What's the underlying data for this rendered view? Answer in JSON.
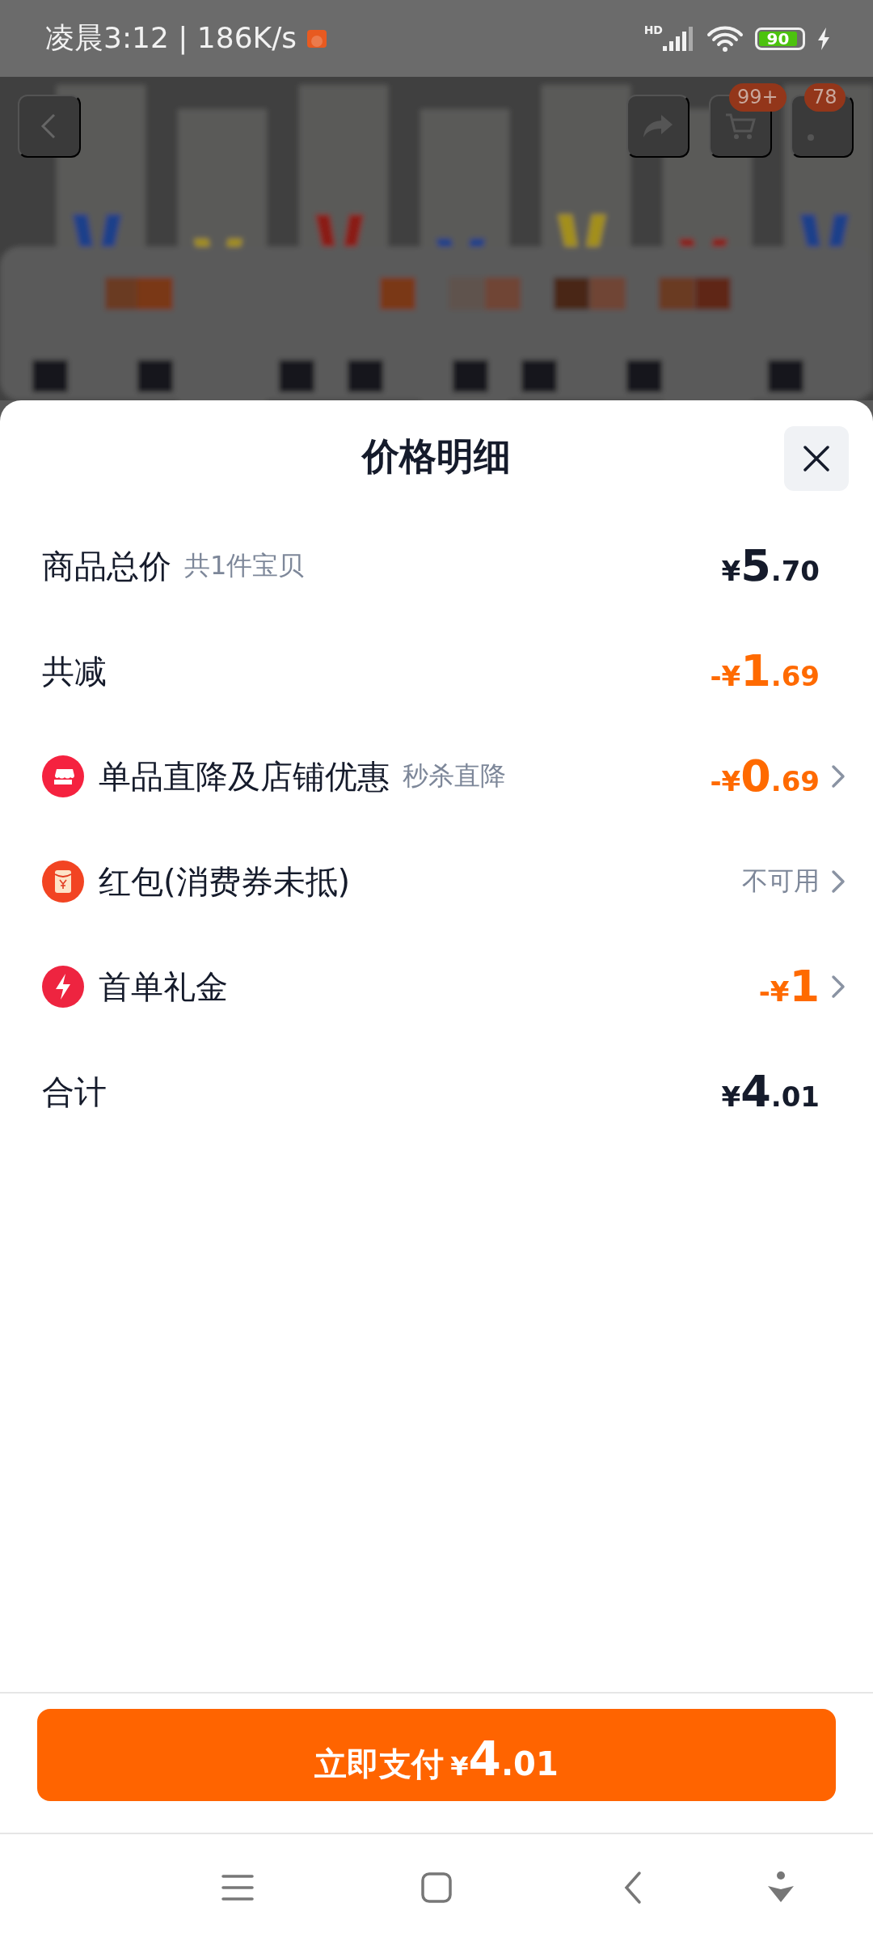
{
  "status_bar": {
    "time": "凌晨3:12 | 186K/s",
    "network": "HD",
    "battery": "90"
  },
  "top_nav": {
    "cart_badge": "99+",
    "message_badge": "78"
  },
  "sheet": {
    "title": "价格明细",
    "rows": [
      {
        "kind": "subtotal",
        "label": "商品总价",
        "note": "共1件宝贝",
        "amount": {
          "prefix": "¥",
          "integer": "5",
          "fraction": ".70"
        }
      },
      {
        "kind": "savings",
        "label": "共减",
        "amount": {
          "prefix": "-¥",
          "integer": "1",
          "fraction": ".69"
        }
      },
      {
        "kind": "store",
        "label": "单品直降及店铺优惠",
        "note": "秒杀直降",
        "amount": {
          "prefix": "-¥",
          "integer": "0",
          "fraction": ".69"
        }
      },
      {
        "kind": "packet",
        "label": "红包(消费券未抵)",
        "status": "不可用"
      },
      {
        "kind": "gift",
        "label": "首单礼金",
        "amount": {
          "prefix": "-¥",
          "integer": "1"
        }
      },
      {
        "kind": "total",
        "label": "合计",
        "amount": {
          "prefix": "¥",
          "integer": "4",
          "fraction": ".01"
        }
      }
    ]
  },
  "pay_button": {
    "label": "立即支付",
    "amount": {
      "prefix": "¥",
      "integer": "4",
      "fraction": ".01"
    }
  }
}
